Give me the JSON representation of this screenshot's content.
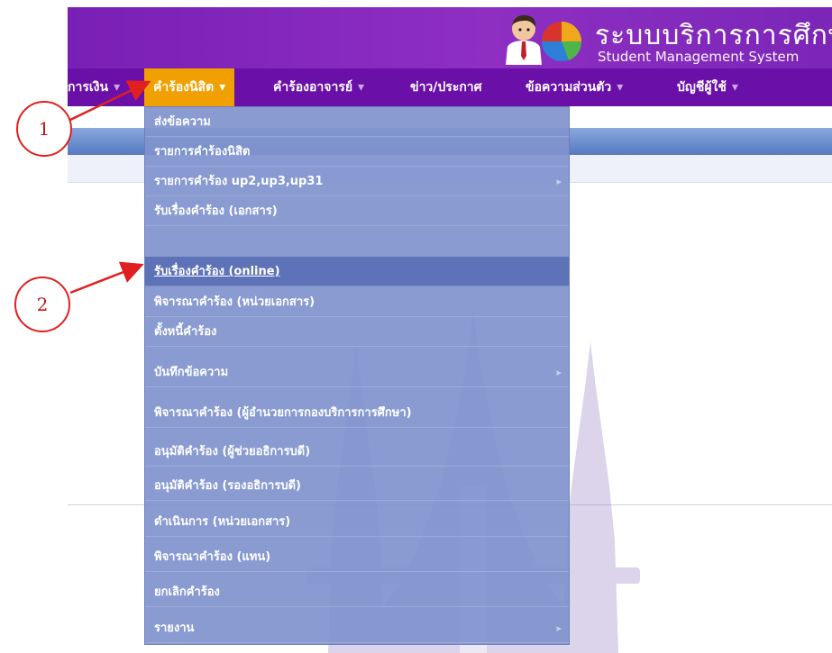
{
  "header": {
    "title_th": "ระบบบริการการศึกษา",
    "title_en": "Student Management System"
  },
  "nav": {
    "items": [
      {
        "label": "การเงิน",
        "active": false
      },
      {
        "label": "คำร้องนิสิต",
        "active": true
      },
      {
        "label": "คำร้องอาจารย์",
        "active": false
      },
      {
        "label": "ข่าว/ประกาศ",
        "active": false
      },
      {
        "label": "ข้อความส่วนตัว",
        "active": false
      },
      {
        "label": "บัญชีผู้ใช้",
        "active": false
      }
    ]
  },
  "dropdown": {
    "items": [
      {
        "label": "ส่งข้อความ"
      },
      {
        "label": "รายการคำร้องนิสิต"
      },
      {
        "label": "รายการคำร้อง up2,up3,up31",
        "submenu": true
      },
      {
        "label": "รับเรื่องคำร้อง (เอกสาร)"
      },
      {
        "label": "รับเรื่องคำร้อง (online)",
        "highlighted": true
      },
      {
        "label": "พิจารณาคำร้อง (หน่วยเอกสาร)"
      },
      {
        "label": "ตั้งหนี้คำร้อง"
      },
      {
        "label": "บันทึกข้อความ",
        "submenu": true
      },
      {
        "label": "พิจารณาคำร้อง (ผู้อำนวยการกองบริการการศึกษา)"
      },
      {
        "label": "อนุมัติคำร้อง (ผู้ช่วยอธิการบดี)"
      },
      {
        "label": "อนุมัติคำร้อง (รองอธิการบดี)"
      },
      {
        "label": "ดำเนินการ (หน่วยเอกสาร)"
      },
      {
        "label": "พิจารณาคำร้อง (แทน)"
      },
      {
        "label": "ยกเลิกคำร้อง"
      },
      {
        "label": "รายงาน",
        "submenu": true
      }
    ]
  },
  "annotations": [
    {
      "label": "1"
    },
    {
      "label": "2"
    }
  ],
  "colors": {
    "header": "#7a1fb5",
    "nav": "#6a0fa8",
    "active_tab": "#f0a000",
    "dropdown": "#8093ce",
    "highlight": "#5e72b7",
    "annotation": "#e02020"
  }
}
